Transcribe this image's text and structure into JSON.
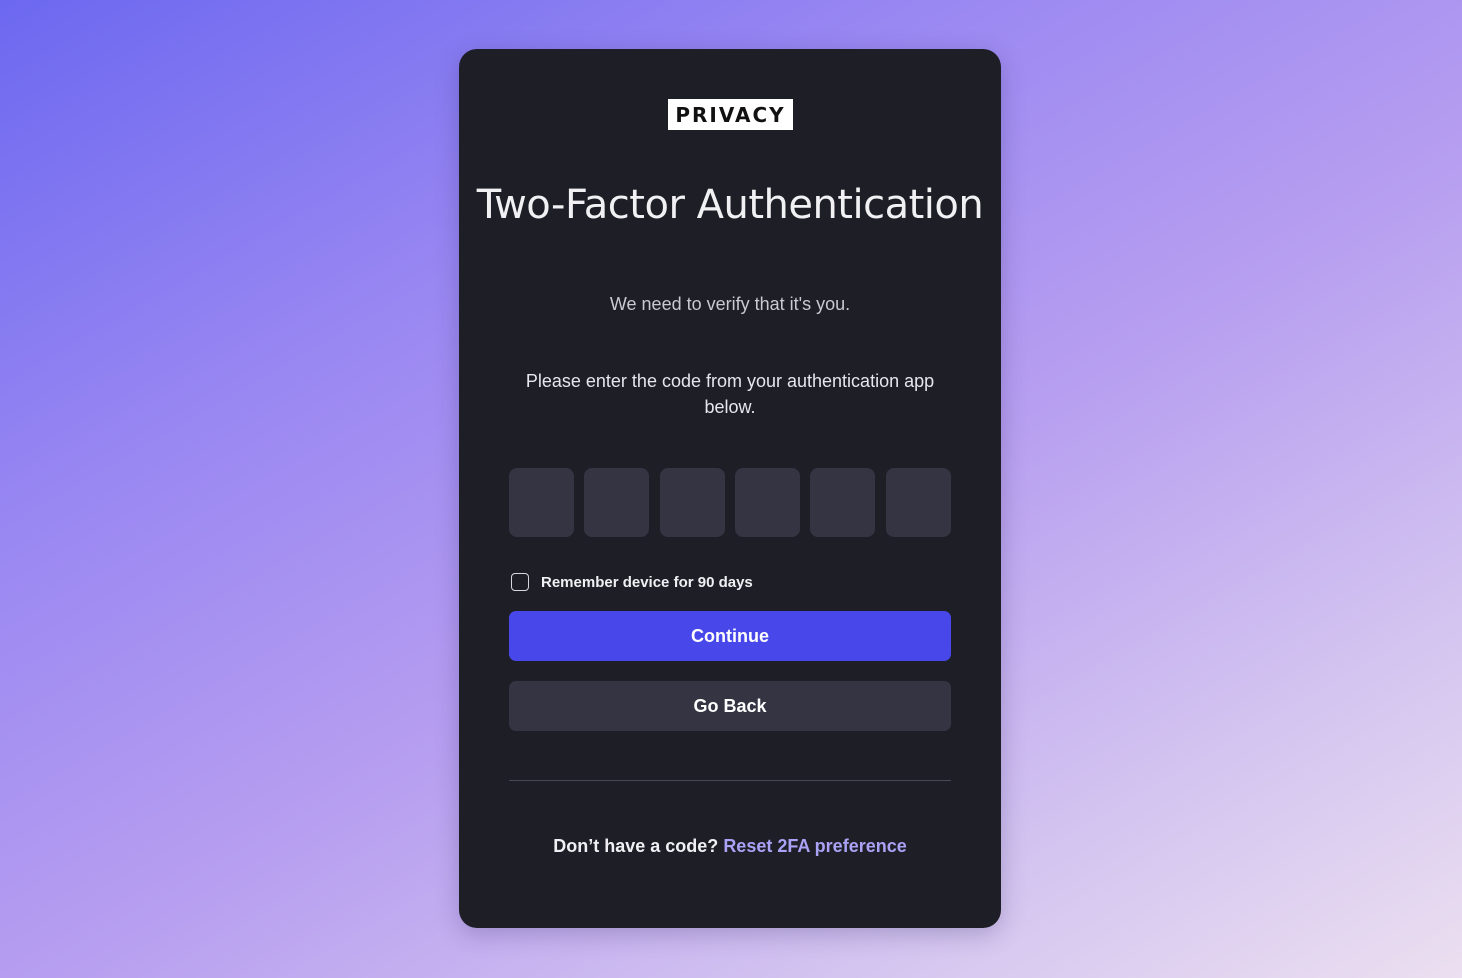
{
  "brand": {
    "logo_text": "PRIVACY"
  },
  "header": {
    "title": "Two-Factor Authentication",
    "subtitle": "We need to verify that it's you."
  },
  "form": {
    "instructions": "Please enter the code from your authentication app below.",
    "code_digits": [
      "",
      "",
      "",
      "",
      "",
      ""
    ],
    "remember_label": "Remember device for 90 days",
    "remember_checked": false,
    "continue_label": "Continue",
    "go_back_label": "Go Back"
  },
  "footer": {
    "prompt_text": "Don’t have a code?",
    "reset_link_label": "Reset 2FA preference"
  },
  "colors": {
    "card_background": "#1e1e26",
    "primary_button": "#4848ea",
    "secondary_button": "#343443",
    "link": "#a9a2f5"
  }
}
